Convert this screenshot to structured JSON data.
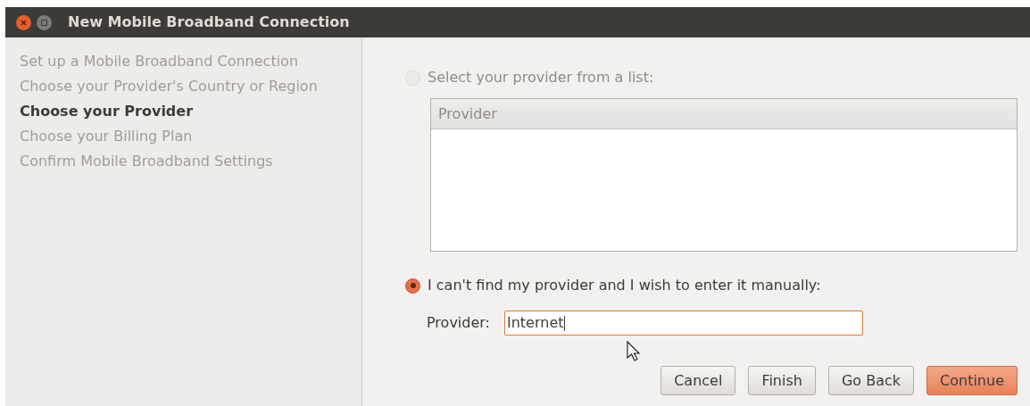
{
  "window": {
    "title": "New Mobile Broadband Connection"
  },
  "steps": [
    {
      "label": "Set up a Mobile Broadband Connection",
      "selected": false
    },
    {
      "label": "Choose your Provider's Country or Region",
      "selected": false
    },
    {
      "label": "Choose your Provider",
      "selected": true
    },
    {
      "label": "Choose your Billing Plan",
      "selected": false
    },
    {
      "label": "Confirm Mobile Broadband Settings",
      "selected": false
    }
  ],
  "options": [
    {
      "label": "Select your provider from a list:",
      "selected": false,
      "disabled": true
    },
    {
      "label": "I can't find my provider and I wish to enter it manually:",
      "selected": true,
      "disabled": false
    }
  ],
  "provider_list": {
    "columns": [
      "Provider"
    ]
  },
  "provider_field": {
    "label": "Provider:",
    "value": "Internet"
  },
  "buttons": [
    {
      "label": "Cancel",
      "default": false
    },
    {
      "label": "Finish",
      "default": false
    },
    {
      "label": "Go Back",
      "default": false
    },
    {
      "label": "Continue",
      "default": true
    }
  ]
}
